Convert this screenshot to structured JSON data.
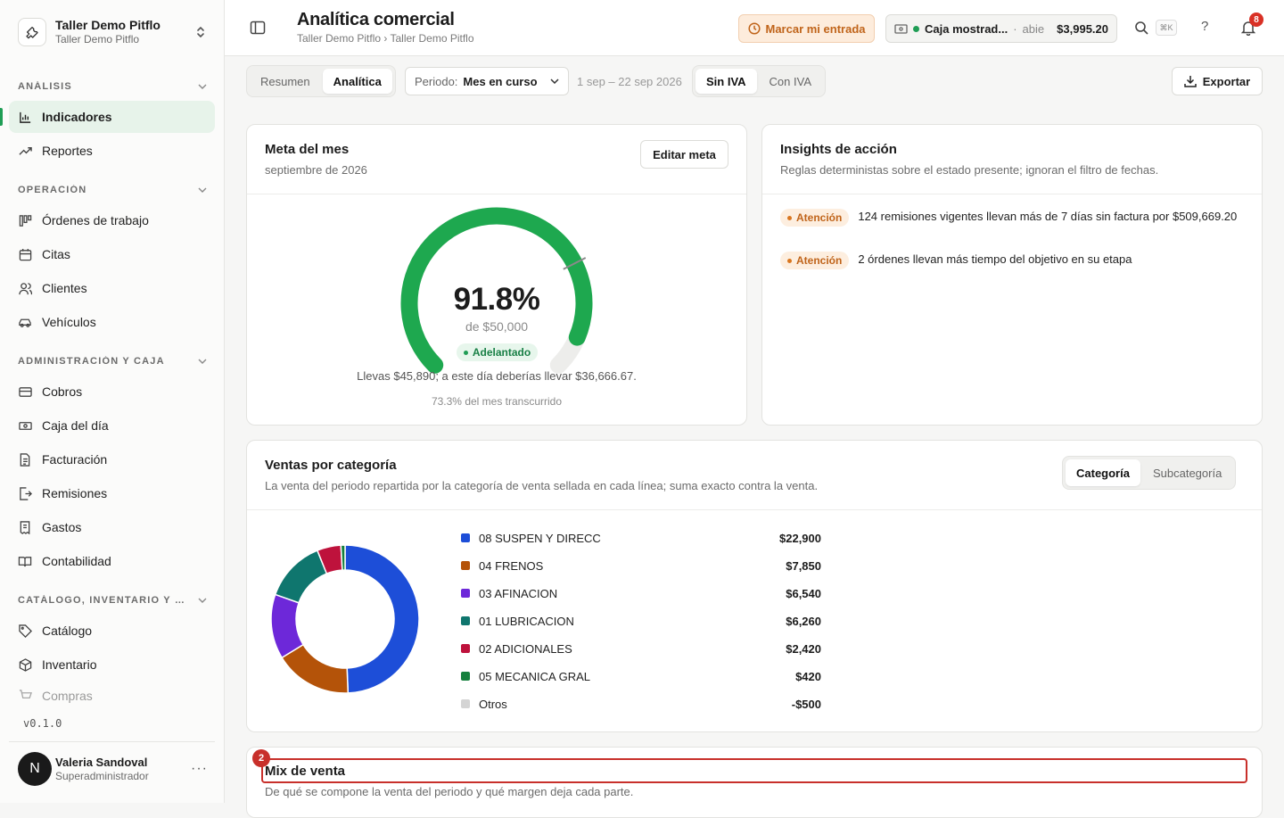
{
  "workspace": {
    "name": "Taller Demo Pitflo",
    "subtitle": "Taller Demo Pitflo"
  },
  "sidebar": {
    "sections": [
      {
        "label": "ANÁLISIS",
        "items": [
          "Indicadores",
          "Reportes"
        ]
      },
      {
        "label": "OPERACIÓN",
        "items": [
          "Órdenes de trabajo",
          "Citas",
          "Clientes",
          "Vehículos"
        ]
      },
      {
        "label": "ADMINISTRACIÓN Y CAJA",
        "items": [
          "Cobros",
          "Caja del día",
          "Facturación",
          "Remisiones",
          "Gastos",
          "Contabilidad"
        ]
      },
      {
        "label": "CATÁLOGO, INVENTARIO Y COMPRAS",
        "items": [
          "Catálogo",
          "Inventario",
          "Compras"
        ]
      }
    ],
    "active_item": "Indicadores",
    "version": "v0.1.0",
    "user": {
      "initial": "N",
      "name": "Valeria Sandoval",
      "role": "Superadministrador",
      "more": "···"
    }
  },
  "header": {
    "title": "Analítica comercial",
    "breadcrumb": "Taller Demo Pitflo › Taller Demo Pitflo",
    "clock_in_label": "Marcar mi entrada",
    "register": {
      "name": "Caja mostrad...",
      "status": "abie",
      "amount": "$3,995.20"
    },
    "shortcut": "⌘K",
    "help": "?",
    "notifications_count": "8"
  },
  "toolbar": {
    "view_tabs": [
      "Resumen",
      "Analítica"
    ],
    "active_view": "Analítica",
    "period_label": "Periodo:",
    "period_value": "Mes en curso",
    "date_range": "1 sep – 22 sep 2026",
    "tax_tabs": [
      "Sin IVA",
      "Con IVA"
    ],
    "active_tax": "Sin IVA",
    "export_label": "Exportar"
  },
  "goal": {
    "title": "Meta del mes",
    "subtitle": "septiembre de 2026",
    "edit_label": "Editar meta",
    "percent_text": "91.8%",
    "progress": 0.918,
    "expected_progress": 0.733,
    "target_text": "de $50,000",
    "status": "Adelantado",
    "summary": "Llevas $45,890; a este día deberías llevar $36,666.67.",
    "elapsed": "73.3% del mes transcurrido",
    "colors": {
      "fill": "#1ea84f",
      "track": "#ededeb",
      "marker": "#8a8a8a"
    }
  },
  "insights": {
    "title": "Insights de acción",
    "subtitle": "Reglas deterministas sobre el estado presente; ignoran el filtro de fechas.",
    "items": [
      {
        "badge": "Atención",
        "text": "124 remisiones vigentes llevan más de 7 días sin factura por $509,669.20"
      },
      {
        "badge": "Atención",
        "text": "2 órdenes llevan más tiempo del objetivo en su etapa"
      }
    ]
  },
  "sales_by_category": {
    "title": "Ventas por categoría",
    "subtitle": "La venta del periodo repartida por la categoría de venta sellada en cada línea; suma exacto contra la venta.",
    "tabs": [
      "Categoría",
      "Subcategoría"
    ],
    "active_tab": "Categoría",
    "legend": [
      {
        "name": "08 SUSPEN Y DIRECC",
        "amount": "$22,900",
        "color": "#1d4ed8"
      },
      {
        "name": "04 FRENOS",
        "amount": "$7,850",
        "color": "#b45309"
      },
      {
        "name": "03 AFINACION",
        "amount": "$6,540",
        "color": "#6d28d9"
      },
      {
        "name": "01 LUBRICACION",
        "amount": "$6,260",
        "color": "#0f766e"
      },
      {
        "name": "02 ADICIONALES",
        "amount": "$2,420",
        "color": "#be123c"
      },
      {
        "name": "05 MECANICA GRAL",
        "amount": "$420",
        "color": "#15803d"
      },
      {
        "name": "Otros",
        "amount": "-$500",
        "color": "#d4d4d4"
      }
    ],
    "chart_data": {
      "type": "pie",
      "categories": [
        "08 SUSPEN Y DIRECC",
        "04 FRENOS",
        "03 AFINACION",
        "01 LUBRICACION",
        "02 ADICIONALES",
        "05 MECANICA GRAL"
      ],
      "values": [
        22900,
        7850,
        6540,
        6260,
        2420,
        420
      ],
      "colors": [
        "#1d4ed8",
        "#b45309",
        "#6d28d9",
        "#0f766e",
        "#be123c",
        "#15803d"
      ]
    }
  },
  "mix": {
    "marker": "2",
    "title": "Mix de venta",
    "subtitle": "De qué se compone la venta del periodo y qué margen deja cada parte."
  }
}
